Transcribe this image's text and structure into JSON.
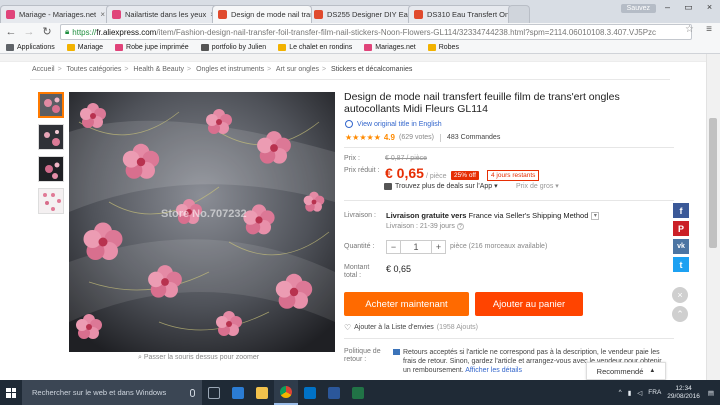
{
  "browser": {
    "tabs": [
      {
        "label": "Mariage - Mariages.net",
        "fav_color": "#e0447a"
      },
      {
        "label": "Nailartiste dans les yeux",
        "fav_color": "#e0447a"
      },
      {
        "label": "Design de mode nail tran",
        "fav_color": "#e04a2d"
      },
      {
        "label": "DS255 Designer DIY Eau",
        "fav_color": "#e04a2d"
      },
      {
        "label": "DS310 Eau Transfert Ongl",
        "fav_color": "#e04a2d"
      }
    ],
    "user_label": "Sauvez",
    "url_https": "https://",
    "url_host": "fr.aliexpress.com",
    "url_path": "/item/Fashion-design-nail-transfer-foil-transfer-film-nail-stickers-Noon-Flowers-GL114/32334744238.html?spm=2114.06010108.3.407.VJ5Pzc",
    "bookmarks": [
      {
        "label": "Applications",
        "color": "#5f6368"
      },
      {
        "label": "Mariage",
        "color": "#f2b200"
      },
      {
        "label": "Robe jupe imprimée",
        "color": "#e0447a"
      },
      {
        "label": "portfolio by Julien",
        "color": "#555555"
      },
      {
        "label": "Le chalet en rondins",
        "color": "#f2b200"
      },
      {
        "label": "Mariages.net",
        "color": "#e0447a"
      },
      {
        "label": "Robes",
        "color": "#f2b200"
      }
    ]
  },
  "page": {
    "breadcrumb": [
      "Accueil",
      "Toutes catégories",
      "Health & Beauty",
      "Ongles et instruments",
      "Art sur ongles",
      "Stickers et décalcomanies"
    ],
    "title": "Design de mode nail transfert feuille film de trans'ert ongles autocollants Midi Fleurs GL114",
    "view_original": "View original title in English",
    "rating_score": "4.9",
    "votes": "(629 votes)",
    "orders": "483 Commandes",
    "price_label": "Prix :",
    "price_old": "€ 0,87 / pièce",
    "discount_label": "Prix réduit :",
    "price_now": "€ 0,65",
    "price_unit": "/ pièce",
    "off_badge": "25% off",
    "days_badge": "4 jours restants",
    "deals_link": "Trouvez plus de deals sur l'App ▾",
    "group_price": "Prix de gros ▾",
    "shipping_label": "Livraison :",
    "shipping_main_bold": "Livraison gratuite vers",
    "shipping_main_rest": "France via Seller's Shipping Method",
    "shipping_time": "Livraison : 21-39 jours",
    "quantity_label": "Quantité :",
    "quantity_value": "1",
    "quantity_note": "pièce (216 morceaux available)",
    "total_label": "Montant total :",
    "total_value": "€ 0,65",
    "buy_now": "Acheter maintenant",
    "add_cart": "Ajouter au panier",
    "wishlist": "Ajouter à la Liste d'envies",
    "wishlist_count": "(1958 Ajouts)",
    "return_label": "Politique de retour :",
    "return_text": "Retours acceptés si l'article ne correspond pas à la description, le vendeur paie les frais de retour. Sinon, gardez l'article et arrangez-vous avec le vendeur pour obtenir un remboursement.",
    "return_link": "Afficher les détails",
    "watermark": "Store No.707232",
    "zoom_hint": "Passer la souris dessus pour zoomer",
    "recommended": "Recommendé",
    "social": [
      {
        "glyph": "f",
        "color": "#3b5998"
      },
      {
        "glyph": "P",
        "color": "#cb2027"
      },
      {
        "glyph": "vk",
        "color": "#4c75a3"
      },
      {
        "glyph": "t",
        "color": "#1da1f2"
      }
    ]
  },
  "taskbar": {
    "search_placeholder": "Rechercher sur le web et dans Windows",
    "apps": [
      {
        "name": "task-view",
        "color": "#9aa7b5"
      },
      {
        "name": "edge",
        "color": "#2b7cd3"
      },
      {
        "name": "file-explorer",
        "color": "#f2c24c"
      },
      {
        "name": "chrome",
        "color": "#4caf50"
      },
      {
        "name": "outlook",
        "color": "#0072c6"
      },
      {
        "name": "word",
        "color": "#2b579a"
      },
      {
        "name": "excel",
        "color": "#217346"
      }
    ],
    "lang": "FRA",
    "time": "12:34",
    "date": "29/08/2016"
  }
}
